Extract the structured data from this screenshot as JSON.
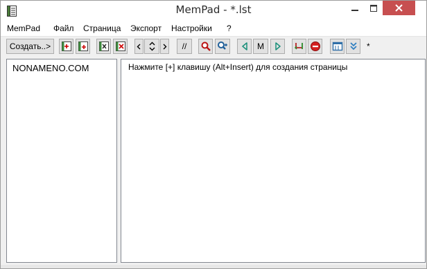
{
  "window": {
    "title": "MemPad - *.lst"
  },
  "menu": {
    "items": [
      {
        "label": "MemPad"
      },
      {
        "label": "Файл"
      },
      {
        "label": "Страница"
      },
      {
        "label": "Экспорт"
      },
      {
        "label": "Настройки"
      },
      {
        "label": "?"
      }
    ]
  },
  "toolbar": {
    "create_label": "Создать..>",
    "comment_label": "//",
    "m_label": "M",
    "modified_marker": "*",
    "icons": [
      "add-page-icon",
      "add-subpage-icon",
      "cut-page-icon",
      "delete-page-icon",
      "arrow-left-icon",
      "arrow-up-down-icon",
      "arrow-right-icon",
      "find-icon",
      "find-next-icon",
      "back-icon",
      "forward-icon",
      "undo-icon",
      "stop-icon",
      "window-icon",
      "expand-icon"
    ]
  },
  "tree": {
    "items": [
      {
        "label": "NONAMENO.COM"
      }
    ]
  },
  "editor": {
    "hint": "Нажмите [+] клавишу (Alt+Insert) для создания страницы"
  },
  "colors": {
    "close_button": "#c74f50",
    "accent_green": "#2e8b57",
    "accent_red": "#d42020",
    "accent_blue": "#2f7fc1"
  }
}
